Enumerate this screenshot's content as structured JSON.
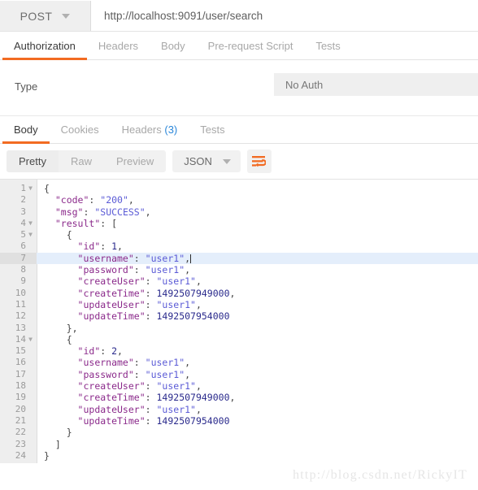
{
  "request_bar": {
    "method": "POST",
    "method_caret_icon": "chevron-down-icon",
    "url": "http://localhost:9091/user/search"
  },
  "request_tabs": [
    {
      "label": "Authorization",
      "active": true
    },
    {
      "label": "Headers",
      "active": false
    },
    {
      "label": "Body",
      "active": false
    },
    {
      "label": "Pre-request Script",
      "active": false
    },
    {
      "label": "Tests",
      "active": false
    }
  ],
  "auth_pane": {
    "type_label": "Type",
    "type_value": "No Auth"
  },
  "response_tabs": [
    {
      "label": "Body",
      "count": "",
      "active": true
    },
    {
      "label": "Cookies",
      "count": "",
      "active": false
    },
    {
      "label": "Headers",
      "count": "(3)",
      "active": false
    },
    {
      "label": "Tests",
      "count": "",
      "active": false
    }
  ],
  "response_toolbar": {
    "view_modes": [
      {
        "label": "Pretty",
        "active": true
      },
      {
        "label": "Raw",
        "active": false
      },
      {
        "label": "Preview",
        "active": false
      }
    ],
    "format": "JSON",
    "format_caret_icon": "chevron-down-icon",
    "wrap_icon": "word-wrap-icon",
    "accent_color": "#f26b22"
  },
  "code": {
    "language": "json",
    "highlighted_line": 7,
    "lines": [
      {
        "no": "1",
        "fold": true,
        "tokens": [
          {
            "t": "{",
            "c": "p"
          }
        ]
      },
      {
        "no": "2",
        "fold": false,
        "tokens": [
          {
            "t": "  ",
            "c": "p"
          },
          {
            "t": "\"code\"",
            "c": "k"
          },
          {
            "t": ": ",
            "c": "p"
          },
          {
            "t": "\"200\"",
            "c": "s"
          },
          {
            "t": ",",
            "c": "p"
          }
        ]
      },
      {
        "no": "3",
        "fold": false,
        "tokens": [
          {
            "t": "  ",
            "c": "p"
          },
          {
            "t": "\"msg\"",
            "c": "k"
          },
          {
            "t": ": ",
            "c": "p"
          },
          {
            "t": "\"SUCCESS\"",
            "c": "s"
          },
          {
            "t": ",",
            "c": "p"
          }
        ]
      },
      {
        "no": "4",
        "fold": true,
        "tokens": [
          {
            "t": "  ",
            "c": "p"
          },
          {
            "t": "\"result\"",
            "c": "k"
          },
          {
            "t": ": [",
            "c": "p"
          }
        ]
      },
      {
        "no": "5",
        "fold": true,
        "tokens": [
          {
            "t": "    {",
            "c": "p"
          }
        ]
      },
      {
        "no": "6",
        "fold": false,
        "tokens": [
          {
            "t": "      ",
            "c": "p"
          },
          {
            "t": "\"id\"",
            "c": "k"
          },
          {
            "t": ": ",
            "c": "p"
          },
          {
            "t": "1",
            "c": "n"
          },
          {
            "t": ",",
            "c": "p"
          }
        ]
      },
      {
        "no": "7",
        "fold": false,
        "cursor": true,
        "tokens": [
          {
            "t": "      ",
            "c": "p"
          },
          {
            "t": "\"username\"",
            "c": "k"
          },
          {
            "t": ": ",
            "c": "p"
          },
          {
            "t": "\"user1\"",
            "c": "s"
          },
          {
            "t": ",",
            "c": "p"
          }
        ]
      },
      {
        "no": "8",
        "fold": false,
        "tokens": [
          {
            "t": "      ",
            "c": "p"
          },
          {
            "t": "\"password\"",
            "c": "k"
          },
          {
            "t": ": ",
            "c": "p"
          },
          {
            "t": "\"user1\"",
            "c": "s"
          },
          {
            "t": ",",
            "c": "p"
          }
        ]
      },
      {
        "no": "9",
        "fold": false,
        "tokens": [
          {
            "t": "      ",
            "c": "p"
          },
          {
            "t": "\"createUser\"",
            "c": "k"
          },
          {
            "t": ": ",
            "c": "p"
          },
          {
            "t": "\"user1\"",
            "c": "s"
          },
          {
            "t": ",",
            "c": "p"
          }
        ]
      },
      {
        "no": "10",
        "fold": false,
        "tokens": [
          {
            "t": "      ",
            "c": "p"
          },
          {
            "t": "\"createTime\"",
            "c": "k"
          },
          {
            "t": ": ",
            "c": "p"
          },
          {
            "t": "1492507949000",
            "c": "n"
          },
          {
            "t": ",",
            "c": "p"
          }
        ]
      },
      {
        "no": "11",
        "fold": false,
        "tokens": [
          {
            "t": "      ",
            "c": "p"
          },
          {
            "t": "\"updateUser\"",
            "c": "k"
          },
          {
            "t": ": ",
            "c": "p"
          },
          {
            "t": "\"user1\"",
            "c": "s"
          },
          {
            "t": ",",
            "c": "p"
          }
        ]
      },
      {
        "no": "12",
        "fold": false,
        "tokens": [
          {
            "t": "      ",
            "c": "p"
          },
          {
            "t": "\"updateTime\"",
            "c": "k"
          },
          {
            "t": ": ",
            "c": "p"
          },
          {
            "t": "1492507954000",
            "c": "n"
          }
        ]
      },
      {
        "no": "13",
        "fold": false,
        "tokens": [
          {
            "t": "    },",
            "c": "p"
          }
        ]
      },
      {
        "no": "14",
        "fold": true,
        "tokens": [
          {
            "t": "    {",
            "c": "p"
          }
        ]
      },
      {
        "no": "15",
        "fold": false,
        "tokens": [
          {
            "t": "      ",
            "c": "p"
          },
          {
            "t": "\"id\"",
            "c": "k"
          },
          {
            "t": ": ",
            "c": "p"
          },
          {
            "t": "2",
            "c": "n"
          },
          {
            "t": ",",
            "c": "p"
          }
        ]
      },
      {
        "no": "16",
        "fold": false,
        "tokens": [
          {
            "t": "      ",
            "c": "p"
          },
          {
            "t": "\"username\"",
            "c": "k"
          },
          {
            "t": ": ",
            "c": "p"
          },
          {
            "t": "\"user1\"",
            "c": "s"
          },
          {
            "t": ",",
            "c": "p"
          }
        ]
      },
      {
        "no": "17",
        "fold": false,
        "tokens": [
          {
            "t": "      ",
            "c": "p"
          },
          {
            "t": "\"password\"",
            "c": "k"
          },
          {
            "t": ": ",
            "c": "p"
          },
          {
            "t": "\"user1\"",
            "c": "s"
          },
          {
            "t": ",",
            "c": "p"
          }
        ]
      },
      {
        "no": "18",
        "fold": false,
        "tokens": [
          {
            "t": "      ",
            "c": "p"
          },
          {
            "t": "\"createUser\"",
            "c": "k"
          },
          {
            "t": ": ",
            "c": "p"
          },
          {
            "t": "\"user1\"",
            "c": "s"
          },
          {
            "t": ",",
            "c": "p"
          }
        ]
      },
      {
        "no": "19",
        "fold": false,
        "tokens": [
          {
            "t": "      ",
            "c": "p"
          },
          {
            "t": "\"createTime\"",
            "c": "k"
          },
          {
            "t": ": ",
            "c": "p"
          },
          {
            "t": "1492507949000",
            "c": "n"
          },
          {
            "t": ",",
            "c": "p"
          }
        ]
      },
      {
        "no": "20",
        "fold": false,
        "tokens": [
          {
            "t": "      ",
            "c": "p"
          },
          {
            "t": "\"updateUser\"",
            "c": "k"
          },
          {
            "t": ": ",
            "c": "p"
          },
          {
            "t": "\"user1\"",
            "c": "s"
          },
          {
            "t": ",",
            "c": "p"
          }
        ]
      },
      {
        "no": "21",
        "fold": false,
        "tokens": [
          {
            "t": "      ",
            "c": "p"
          },
          {
            "t": "\"updateTime\"",
            "c": "k"
          },
          {
            "t": ": ",
            "c": "p"
          },
          {
            "t": "1492507954000",
            "c": "n"
          }
        ]
      },
      {
        "no": "22",
        "fold": false,
        "tokens": [
          {
            "t": "    }",
            "c": "p"
          }
        ]
      },
      {
        "no": "23",
        "fold": false,
        "tokens": [
          {
            "t": "  ]",
            "c": "p"
          }
        ]
      },
      {
        "no": "24",
        "fold": false,
        "tokens": [
          {
            "t": "}",
            "c": "p"
          }
        ]
      }
    ]
  },
  "watermark": "http://blog.csdn.net/RickyIT"
}
